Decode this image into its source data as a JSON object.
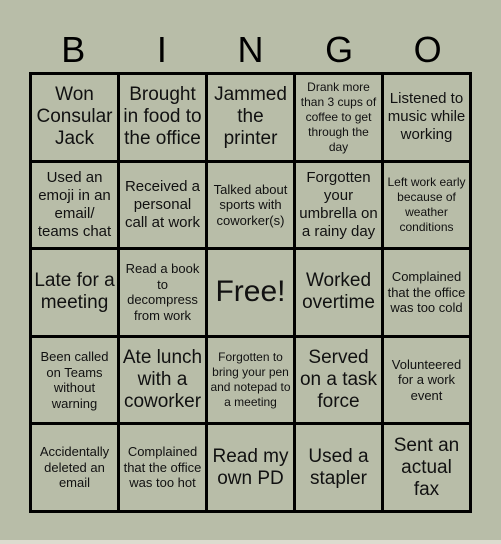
{
  "header": {
    "letters": [
      "B",
      "I",
      "N",
      "G",
      "O"
    ]
  },
  "card": {
    "rows": [
      [
        "Won Consular Jack",
        "Brought in food to the office",
        "Jammed the printer",
        "Drank more than 3 cups of coffee to get through the day",
        "Listened to music while working"
      ],
      [
        "Used an emoji in an email/ teams chat",
        "Received a personal call at work",
        "Talked about sports with coworker(s)",
        "Forgotten your umbrella on a rainy day",
        "Left work early because of weather conditions"
      ],
      [
        "Late for a meeting",
        "Read a book to decompress from work",
        "Free!",
        "Worked overtime",
        "Complained that the office was too cold"
      ],
      [
        "Been called on Teams without warning",
        "Ate lunch with a coworker",
        "Forgotten to bring your pen and notepad to a meeting",
        "Served on a task force",
        "Volunteered for a work event"
      ],
      [
        "Accidentally deleted an email",
        "Complained that the office was too hot",
        "Read my own PD",
        "Used a stapler",
        "Sent an actual fax"
      ]
    ]
  },
  "colors": {
    "background": "#b8bda8",
    "grid_lines": "#000000",
    "text": "#111111"
  }
}
